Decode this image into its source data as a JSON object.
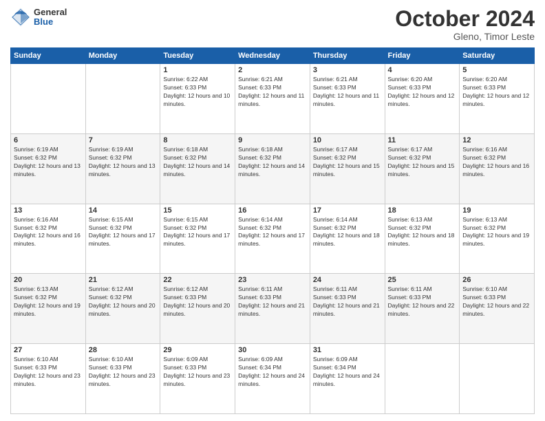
{
  "logo": {
    "general": "General",
    "blue": "Blue"
  },
  "title": {
    "month": "October 2024",
    "location": "Gleno, Timor Leste"
  },
  "headers": [
    "Sunday",
    "Monday",
    "Tuesday",
    "Wednesday",
    "Thursday",
    "Friday",
    "Saturday"
  ],
  "weeks": [
    [
      {
        "day": "",
        "info": ""
      },
      {
        "day": "",
        "info": ""
      },
      {
        "day": "1",
        "info": "Sunrise: 6:22 AM\nSunset: 6:33 PM\nDaylight: 12 hours and 10 minutes."
      },
      {
        "day": "2",
        "info": "Sunrise: 6:21 AM\nSunset: 6:33 PM\nDaylight: 12 hours and 11 minutes."
      },
      {
        "day": "3",
        "info": "Sunrise: 6:21 AM\nSunset: 6:33 PM\nDaylight: 12 hours and 11 minutes."
      },
      {
        "day": "4",
        "info": "Sunrise: 6:20 AM\nSunset: 6:33 PM\nDaylight: 12 hours and 12 minutes."
      },
      {
        "day": "5",
        "info": "Sunrise: 6:20 AM\nSunset: 6:33 PM\nDaylight: 12 hours and 12 minutes."
      }
    ],
    [
      {
        "day": "6",
        "info": "Sunrise: 6:19 AM\nSunset: 6:32 PM\nDaylight: 12 hours and 13 minutes."
      },
      {
        "day": "7",
        "info": "Sunrise: 6:19 AM\nSunset: 6:32 PM\nDaylight: 12 hours and 13 minutes."
      },
      {
        "day": "8",
        "info": "Sunrise: 6:18 AM\nSunset: 6:32 PM\nDaylight: 12 hours and 14 minutes."
      },
      {
        "day": "9",
        "info": "Sunrise: 6:18 AM\nSunset: 6:32 PM\nDaylight: 12 hours and 14 minutes."
      },
      {
        "day": "10",
        "info": "Sunrise: 6:17 AM\nSunset: 6:32 PM\nDaylight: 12 hours and 15 minutes."
      },
      {
        "day": "11",
        "info": "Sunrise: 6:17 AM\nSunset: 6:32 PM\nDaylight: 12 hours and 15 minutes."
      },
      {
        "day": "12",
        "info": "Sunrise: 6:16 AM\nSunset: 6:32 PM\nDaylight: 12 hours and 16 minutes."
      }
    ],
    [
      {
        "day": "13",
        "info": "Sunrise: 6:16 AM\nSunset: 6:32 PM\nDaylight: 12 hours and 16 minutes."
      },
      {
        "day": "14",
        "info": "Sunrise: 6:15 AM\nSunset: 6:32 PM\nDaylight: 12 hours and 17 minutes."
      },
      {
        "day": "15",
        "info": "Sunrise: 6:15 AM\nSunset: 6:32 PM\nDaylight: 12 hours and 17 minutes."
      },
      {
        "day": "16",
        "info": "Sunrise: 6:14 AM\nSunset: 6:32 PM\nDaylight: 12 hours and 17 minutes."
      },
      {
        "day": "17",
        "info": "Sunrise: 6:14 AM\nSunset: 6:32 PM\nDaylight: 12 hours and 18 minutes."
      },
      {
        "day": "18",
        "info": "Sunrise: 6:13 AM\nSunset: 6:32 PM\nDaylight: 12 hours and 18 minutes."
      },
      {
        "day": "19",
        "info": "Sunrise: 6:13 AM\nSunset: 6:32 PM\nDaylight: 12 hours and 19 minutes."
      }
    ],
    [
      {
        "day": "20",
        "info": "Sunrise: 6:13 AM\nSunset: 6:32 PM\nDaylight: 12 hours and 19 minutes."
      },
      {
        "day": "21",
        "info": "Sunrise: 6:12 AM\nSunset: 6:32 PM\nDaylight: 12 hours and 20 minutes."
      },
      {
        "day": "22",
        "info": "Sunrise: 6:12 AM\nSunset: 6:33 PM\nDaylight: 12 hours and 20 minutes."
      },
      {
        "day": "23",
        "info": "Sunrise: 6:11 AM\nSunset: 6:33 PM\nDaylight: 12 hours and 21 minutes."
      },
      {
        "day": "24",
        "info": "Sunrise: 6:11 AM\nSunset: 6:33 PM\nDaylight: 12 hours and 21 minutes."
      },
      {
        "day": "25",
        "info": "Sunrise: 6:11 AM\nSunset: 6:33 PM\nDaylight: 12 hours and 22 minutes."
      },
      {
        "day": "26",
        "info": "Sunrise: 6:10 AM\nSunset: 6:33 PM\nDaylight: 12 hours and 22 minutes."
      }
    ],
    [
      {
        "day": "27",
        "info": "Sunrise: 6:10 AM\nSunset: 6:33 PM\nDaylight: 12 hours and 23 minutes."
      },
      {
        "day": "28",
        "info": "Sunrise: 6:10 AM\nSunset: 6:33 PM\nDaylight: 12 hours and 23 minutes."
      },
      {
        "day": "29",
        "info": "Sunrise: 6:09 AM\nSunset: 6:33 PM\nDaylight: 12 hours and 23 minutes."
      },
      {
        "day": "30",
        "info": "Sunrise: 6:09 AM\nSunset: 6:34 PM\nDaylight: 12 hours and 24 minutes."
      },
      {
        "day": "31",
        "info": "Sunrise: 6:09 AM\nSunset: 6:34 PM\nDaylight: 12 hours and 24 minutes."
      },
      {
        "day": "",
        "info": ""
      },
      {
        "day": "",
        "info": ""
      }
    ]
  ]
}
